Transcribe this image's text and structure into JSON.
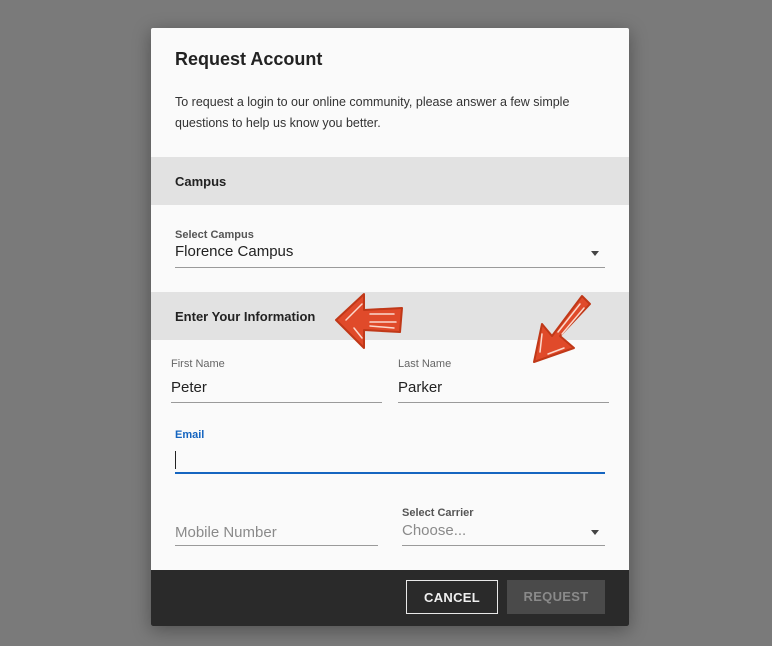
{
  "dialog": {
    "title": "Request Account",
    "intro": "To request a login to our online community, please answer a few simple questions to help us know you better."
  },
  "sections": {
    "campus": "Campus",
    "info": "Enter Your Information"
  },
  "campus_select": {
    "label": "Select Campus",
    "value": "Florence Campus"
  },
  "first_name": {
    "label": "First Name",
    "value": "Peter"
  },
  "last_name": {
    "label": "Last Name",
    "value": "Parker"
  },
  "email": {
    "label": "Email",
    "value": ""
  },
  "mobile": {
    "placeholder": "Mobile Number"
  },
  "carrier_select": {
    "label": "Select Carrier",
    "placeholder": "Choose..."
  },
  "footer": {
    "cancel_label": "CANCEL",
    "request_label": "REQUEST"
  },
  "colors": {
    "backdrop": "#7a7a7a",
    "accent": "#1565c0",
    "arrow": "#e04a2a",
    "footer": "#2a2a2a"
  }
}
